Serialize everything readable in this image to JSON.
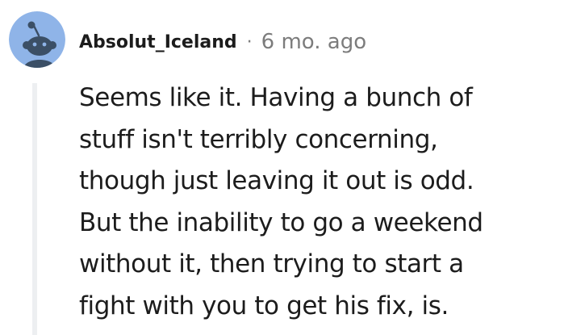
{
  "comment": {
    "author": "Absolut_Iceland",
    "separator": "·",
    "timestamp": "6 mo. ago",
    "avatar_icon": "default-snoo-avatar-icon",
    "body_lines": [
      "Seems like it. Having a bunch of",
      "stuff isn't terribly concerning,",
      "though just leaving it out is odd.",
      "But the inability to go a weekend",
      "without it, then trying to start a",
      "fight with you to get his fix, is."
    ]
  },
  "colors": {
    "avatar_background": "#8fb4e8",
    "snoo_body": "#3b4f66",
    "text_primary": "#1c1c1c",
    "text_meta": "#7c7c7c",
    "thread_line": "#edeff1"
  }
}
